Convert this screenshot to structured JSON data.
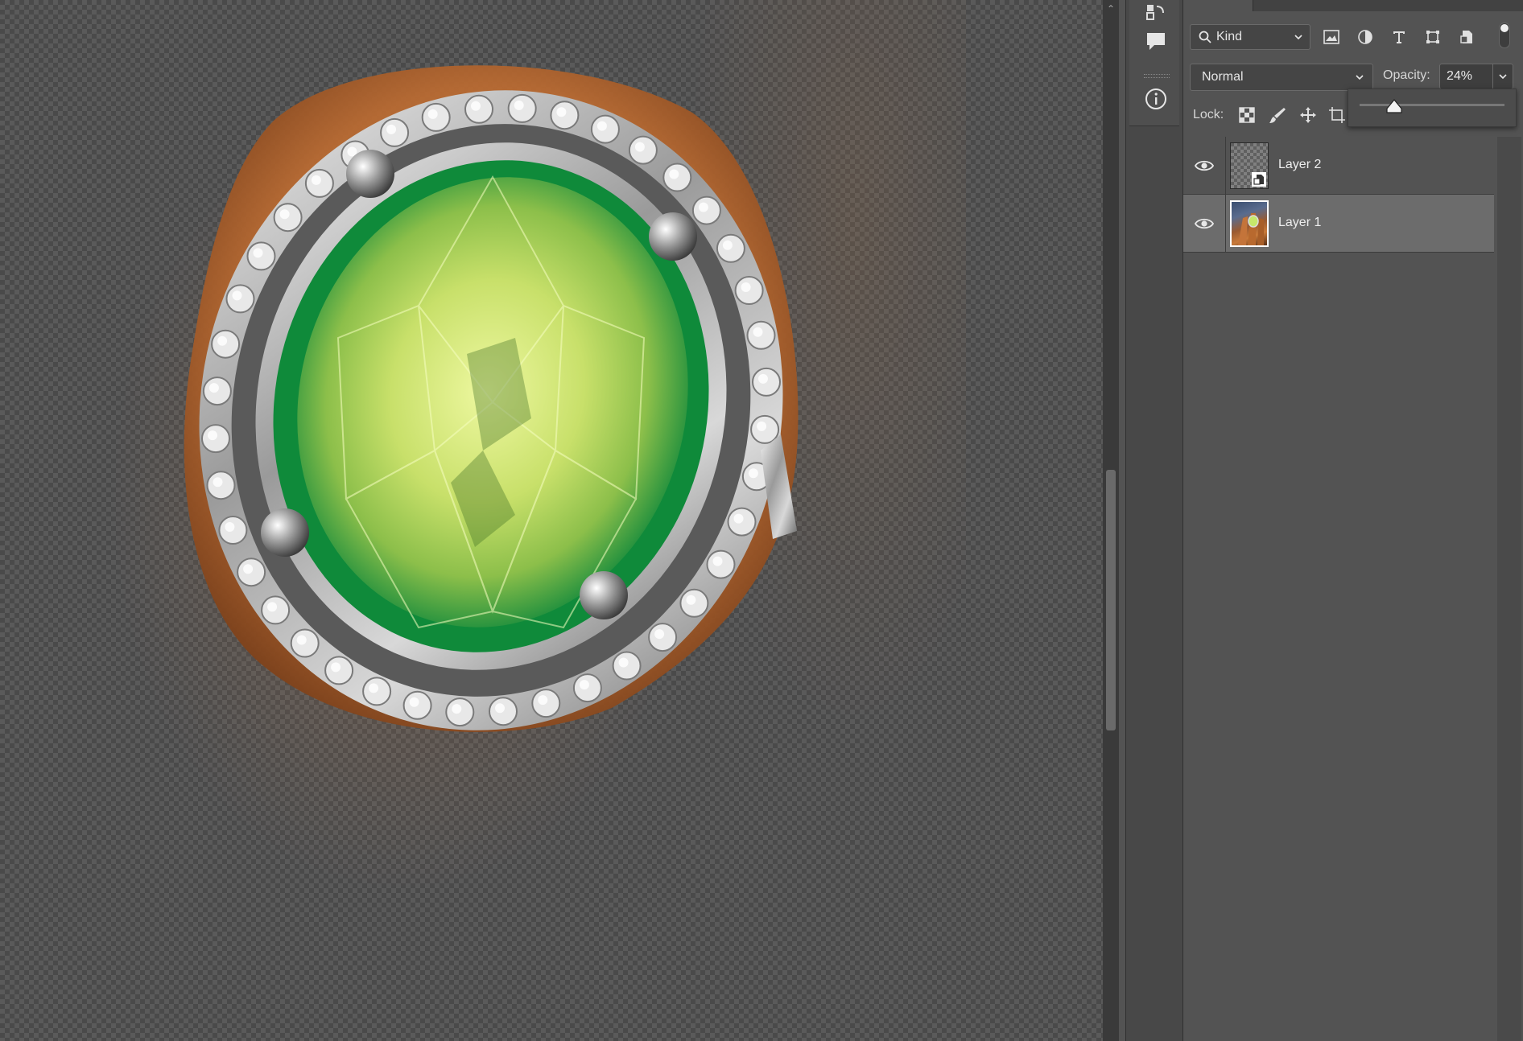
{
  "layers_panel": {
    "filter": {
      "kind_label": "Kind"
    },
    "blend_mode": "Normal",
    "opacity_label": "Opacity:",
    "opacity_value": "24%",
    "opacity_fraction": 0.24,
    "lock_label": "Lock:",
    "layers": [
      {
        "name": "Layer 2",
        "visible": true,
        "selected": false,
        "thumbnail": "transparent-smart-object"
      },
      {
        "name": "Layer 1",
        "visible": true,
        "selected": true,
        "thumbnail": "photo-hand-ring"
      }
    ]
  },
  "side_strip": {
    "icons": [
      "history-icon",
      "comment-icon",
      "info-icon"
    ]
  },
  "colors": {
    "panel_bg": "#535353",
    "selected_row": "#6c6c6c",
    "gem_green": "#1f9a4a",
    "gem_yellow": "#d8ec6a",
    "skin": "#c97a3c"
  }
}
